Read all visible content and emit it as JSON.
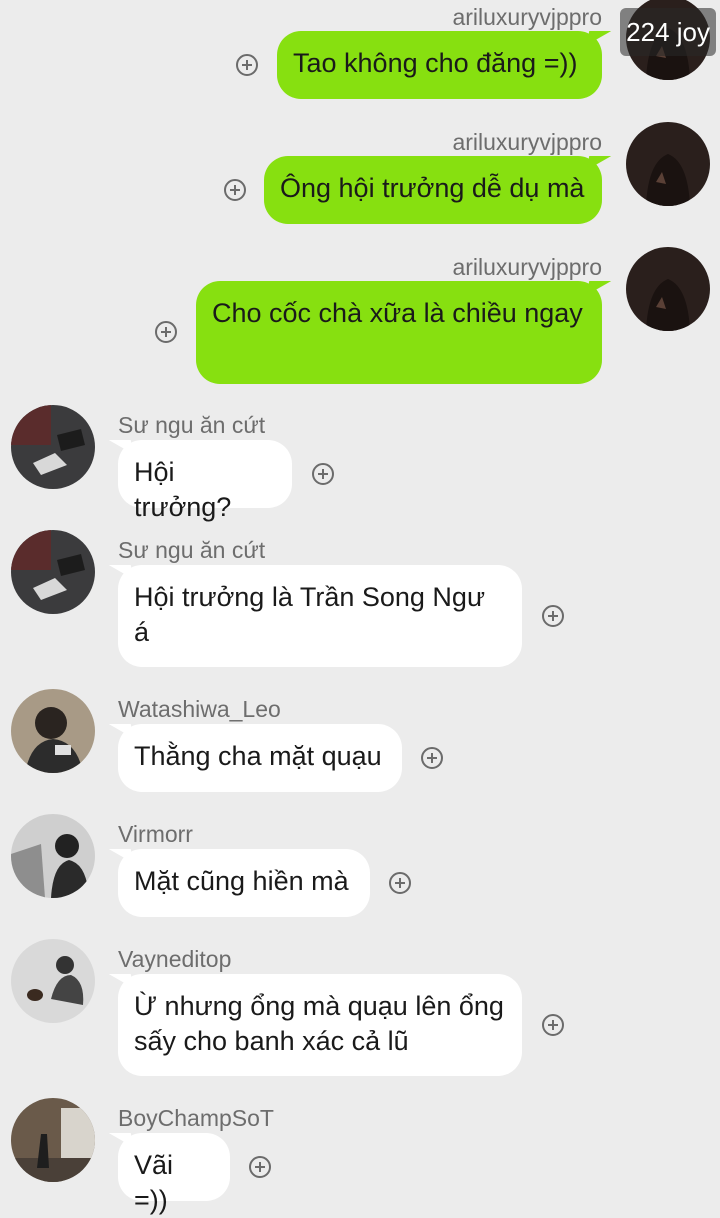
{
  "badge_text": "224 joy",
  "messages": [
    {
      "sender": "ariluxuryvjppro",
      "text": "Tao không cho đăng =))",
      "avatar_icon": "dark-hoodie-avatar"
    },
    {
      "sender": "ariluxuryvjppro",
      "text": "Ông hội trưởng dễ dụ mà",
      "avatar_icon": "dark-hoodie-avatar"
    },
    {
      "sender": "ariluxuryvjppro",
      "text": "Cho cốc chà xữa là chiều ngay",
      "avatar_icon": "dark-hoodie-avatar"
    },
    {
      "sender": "Sư ngu ăn cứt",
      "text": "Hội trưởng?",
      "avatar_icon": "sneakers-photo-avatar"
    },
    {
      "sender": "Sư ngu ăn cứt",
      "text": "Hội trưởng là Trần Song Ngư á",
      "avatar_icon": "sneakers-photo-avatar"
    },
    {
      "sender": "Watashiwa_Leo",
      "text": "Thằng cha mặt quạu",
      "avatar_icon": "man-selfie-avatar"
    },
    {
      "sender": "Virmorr",
      "text": "Mặt cũng hiền mà",
      "avatar_icon": "street-photo-avatar"
    },
    {
      "sender": "Vayneditop",
      "text": "Ừ nhưng ổng mà quạu lên ổng sấy cho banh xác cả lũ",
      "avatar_icon": "man-with-cat-avatar"
    },
    {
      "sender": "BoyChampSoT",
      "text": "Vãi =))",
      "avatar_icon": "alley-photo-avatar"
    }
  ],
  "colors": {
    "background": "#ececec",
    "my_bubble": "#87e010",
    "other_bubble": "#ffffff",
    "sender_name": "#6d6d6d"
  }
}
